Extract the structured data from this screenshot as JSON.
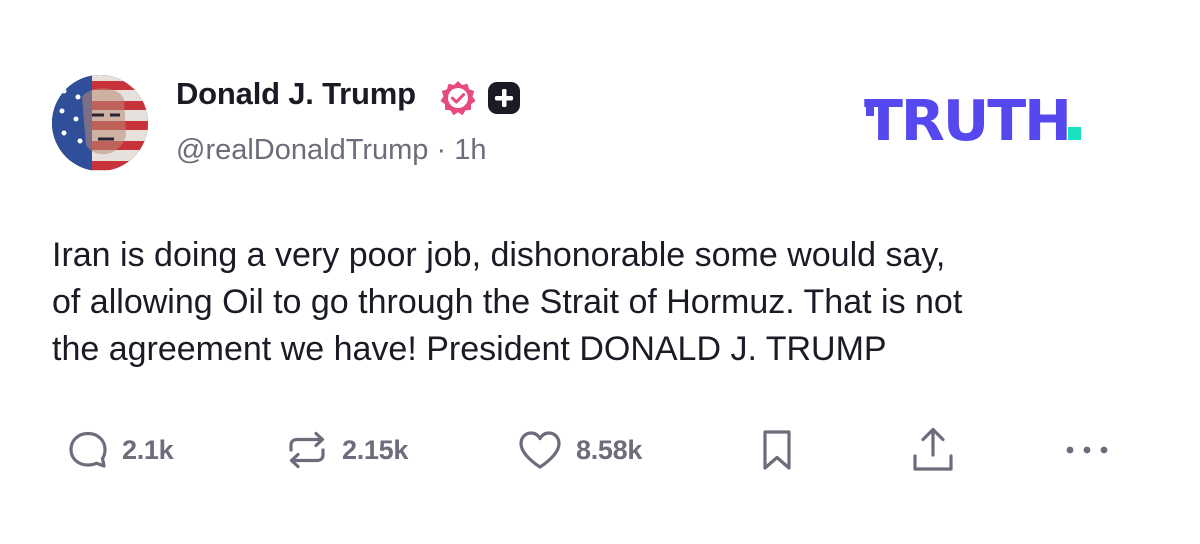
{
  "author": {
    "name": "Donald J. Trump",
    "handle": "@realDonaldTrump",
    "separator": " · ",
    "time": "1h"
  },
  "brand": {
    "logo_text": "TRUTH",
    "logo_color": "#5448ee",
    "logo_dot_color": "#17e3c2"
  },
  "post": {
    "text": "Iran is doing a very poor job, dishonorable some would say,\nof allowing Oil to go through the Strait of Hormuz. That is not\nthe agreement we have! President DONALD J. TRUMP"
  },
  "actions": {
    "replies": "2.1k",
    "reposts": "2.15k",
    "likes": "8.58k"
  },
  "icons": {
    "verified": "verified-badge-icon",
    "plus": "plus-badge-icon",
    "reply": "comment-icon",
    "repost": "repost-icon",
    "like": "heart-icon",
    "save": "bookmark-icon",
    "share": "share-icon",
    "more": "more-icon"
  },
  "colors": {
    "verified": "#e8497f",
    "muted": "#6d6c7a",
    "text": "#1b1a25"
  }
}
